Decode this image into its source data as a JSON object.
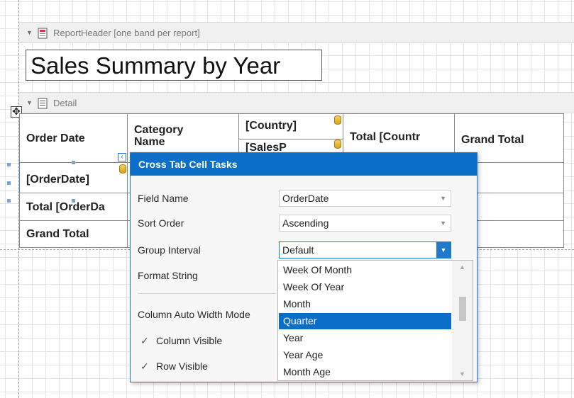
{
  "report_header_band": {
    "label": "ReportHeader [one band per report]",
    "icon": "report-header-icon"
  },
  "report_title": "Sales Summary by Year",
  "detail_band": {
    "label": "Detail",
    "icon": "detail-band-icon"
  },
  "crosstab": {
    "order_date_header": "Order Date",
    "category_name_header": "Category Name",
    "country_header": "[Country]",
    "sales_person_header": "[SalesP",
    "total_country_header": "Total [Countr",
    "grand_total_col_header": "Grand Total",
    "order_date_field": "[OrderDate]",
    "total_order_date": "Total [OrderDa",
    "grand_total_row": "Grand Total"
  },
  "tasks_panel": {
    "title": "Cross Tab Cell Tasks",
    "field_name_label": "Field Name",
    "field_name_value": "OrderDate",
    "sort_order_label": "Sort Order",
    "sort_order_value": "Ascending",
    "group_interval_label": "Group Interval",
    "group_interval_value": "Default",
    "format_string_label": "Format String",
    "column_auto_width_label": "Column Auto Width Mode",
    "column_visible_label": "Column Visible",
    "column_visible_checked": true,
    "row_visible_label": "Row Visible",
    "row_visible_checked": true
  },
  "group_interval_options": [
    "Week Of Month",
    "Week Of Year",
    "Month",
    "Quarter",
    "Year",
    "Year Age",
    "Month Age"
  ],
  "selected_option": "Quarter",
  "colors": {
    "accent": "#0b6fc8",
    "band_bg": "#f0f0f0",
    "grid": "#e4e4e4"
  }
}
